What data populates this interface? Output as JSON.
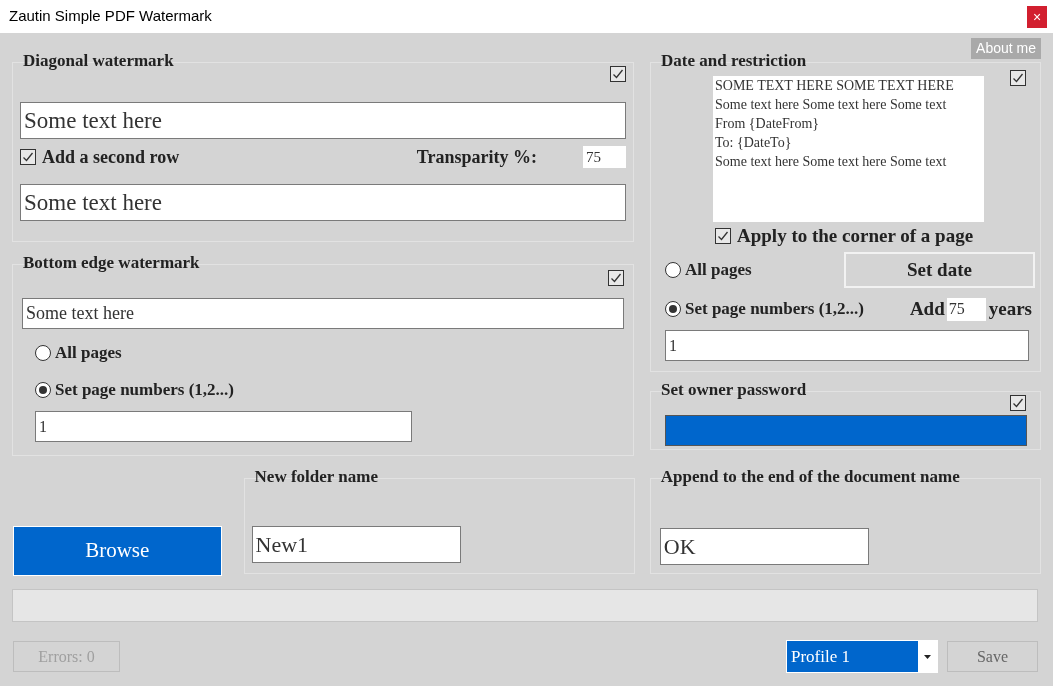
{
  "window": {
    "title": "Zautin Simple PDF Watermark",
    "close": "×"
  },
  "about_button": "About me",
  "diagonal": {
    "title": "Diagonal watermark",
    "enabled": true,
    "row1": "Some text here",
    "second_row": {
      "label": "Add a second row",
      "checked": true
    },
    "transparency_label": "Transparity %:",
    "transparency": "75",
    "row2": "Some text here"
  },
  "bottom_edge": {
    "title": "Bottom edge watermark",
    "enabled": true,
    "text": "Some text here",
    "page_options": [
      {
        "label": "All pages",
        "selected": false
      },
      {
        "label": "Set page numbers (1,2...)",
        "selected": true
      }
    ],
    "pages": "1"
  },
  "date_restriction": {
    "title": "Date and restriction",
    "enabled": true,
    "template_lines": [
      "SOME TEXT HERE SOME TEXT HERE",
      "Some text here Some text here Some text",
      "From {DateFrom}",
      "To: {DateTo}",
      "Some text here Some text here Some text"
    ],
    "corner": {
      "label": "Apply to the corner of a page",
      "checked": true
    },
    "page_options": [
      {
        "label": "All pages",
        "selected": false
      },
      {
        "label": "Set page numbers (1,2...)",
        "selected": true
      }
    ],
    "set_date_button": "Set date",
    "add_label": "Add",
    "years": "75",
    "years_label": "years",
    "pages": "1"
  },
  "owner_password": {
    "title": "Set owner password",
    "enabled": true
  },
  "browse_button": "Browse",
  "new_folder": {
    "title": "New folder name",
    "value": "New1"
  },
  "append_name": {
    "title": "Append to the end of the document name",
    "value": "OK"
  },
  "progress": {
    "level": 0
  },
  "errors_button": {
    "label": "Errors: 0",
    "disabled": true
  },
  "profile": {
    "value": "Profile 1"
  },
  "save_button": "Save"
}
